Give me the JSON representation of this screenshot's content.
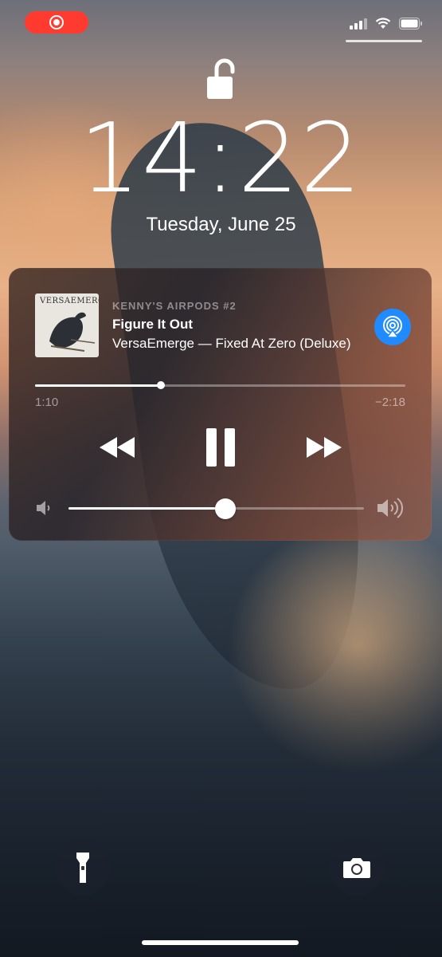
{
  "status_bar": {
    "recording_icon": "screen-recording-icon",
    "signal_icon": "cellular-signal-icon",
    "wifi_icon": "wifi-icon",
    "battery_icon": "battery-icon"
  },
  "lock": {
    "icon": "unlocked-padlock-icon",
    "time": "14:22",
    "date": "Tuesday, June 25"
  },
  "now_playing": {
    "artwork_text": "VERSAEMERGE",
    "device": "KENNY'S AIRPODS #2",
    "title": "Figure It Out",
    "subtitle": "VersaEmerge — Fixed At Zero (Deluxe)",
    "elapsed": "1:10",
    "remaining": "−2:18",
    "progress_fraction": 0.34,
    "volume_fraction": 0.53,
    "accent_color": "#1f8bff",
    "controls": {
      "rewind_icon": "rewind-icon",
      "pause_icon": "pause-icon",
      "forward_icon": "fast-forward-icon",
      "airplay_icon": "airplay-icon",
      "volume_min_icon": "speaker-low-icon",
      "volume_max_icon": "speaker-high-icon"
    }
  },
  "quick_actions": {
    "flashlight_icon": "flashlight-icon",
    "camera_icon": "camera-icon"
  },
  "colors": {
    "recording": "#ff3b30"
  }
}
